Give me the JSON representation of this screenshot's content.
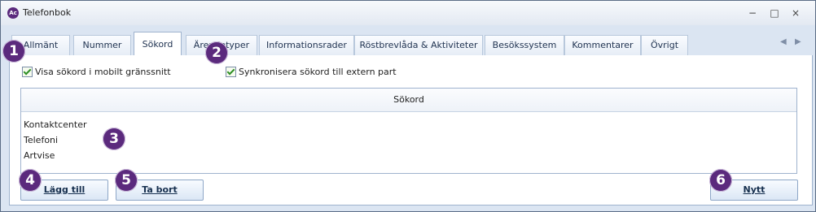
{
  "window": {
    "title": "Telefonbok"
  },
  "tabs": [
    {
      "label": "Allmänt"
    },
    {
      "label": "Nummer"
    },
    {
      "label": "Sökord"
    },
    {
      "label": "Ärendetyper"
    },
    {
      "label": "Informationsrader"
    },
    {
      "label": "Röstbrevlåda & Aktiviteter"
    },
    {
      "label": "Besökssystem"
    },
    {
      "label": "Kommentarer"
    },
    {
      "label": "Övrigt"
    }
  ],
  "options": {
    "show_mobile": "Visa sökord i mobilt gränssnitt",
    "sync_external": "Synkronisera sökord till extern part"
  },
  "list": {
    "header": "Sökord",
    "items": [
      "Kontaktcenter",
      "Telefoni",
      "Artvise"
    ]
  },
  "buttons": {
    "add": "Lägg till",
    "remove": "Ta bort",
    "new": "Nytt"
  },
  "badges": [
    "1",
    "2",
    "3",
    "4",
    "5",
    "6"
  ]
}
